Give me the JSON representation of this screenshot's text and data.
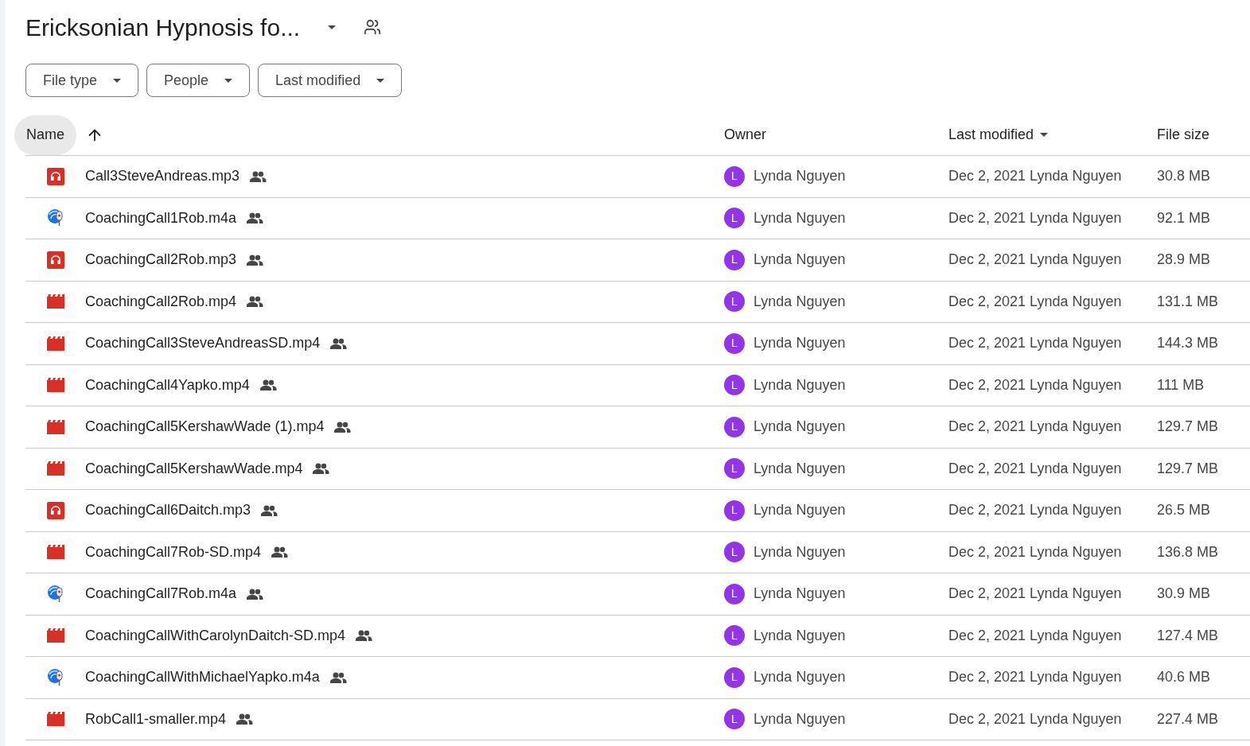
{
  "folder": {
    "title": "Ericksonian Hypnosis fo..."
  },
  "filters": [
    {
      "label": "File type"
    },
    {
      "label": "People"
    },
    {
      "label": "Last modified"
    }
  ],
  "columns": {
    "name": {
      "label": "Name",
      "selected": true
    },
    "owner": "Owner",
    "modified": "Last modified",
    "size": "File size"
  },
  "rows": [
    {
      "name": "Call3SteveAndreas.mp3",
      "kind": "audio",
      "owner": "Lynda Nguyen",
      "initial": "L",
      "color": "#9334e6",
      "modified": "Dec 2, 2021 Lynda Nguyen",
      "size": "30.8 MB"
    },
    {
      "name": "CoachingCall1Rob.m4a",
      "kind": "m4a",
      "owner": "Lynda Nguyen",
      "initial": "L",
      "color": "#9334e6",
      "modified": "Dec 2, 2021 Lynda Nguyen",
      "size": "92.1 MB"
    },
    {
      "name": "CoachingCall2Rob.mp3",
      "kind": "audio",
      "owner": "Lynda Nguyen",
      "initial": "L",
      "color": "#9334e6",
      "modified": "Dec 2, 2021 Lynda Nguyen",
      "size": "28.9 MB"
    },
    {
      "name": "CoachingCall2Rob.mp4",
      "kind": "video",
      "owner": "Lynda Nguyen",
      "initial": "L",
      "color": "#9334e6",
      "modified": "Dec 2, 2021 Lynda Nguyen",
      "size": "131.1 MB"
    },
    {
      "name": "CoachingCall3SteveAndreasSD.mp4",
      "kind": "video",
      "owner": "Lynda Nguyen",
      "initial": "L",
      "color": "#9334e6",
      "modified": "Dec 2, 2021 Lynda Nguyen",
      "size": "144.3 MB"
    },
    {
      "name": "CoachingCall4Yapko.mp4",
      "kind": "video",
      "owner": "Lynda Nguyen",
      "initial": "L",
      "color": "#9334e6",
      "modified": "Dec 2, 2021 Lynda Nguyen",
      "size": "111 MB"
    },
    {
      "name": "CoachingCall5KershawWade (1).mp4",
      "kind": "video",
      "owner": "Lynda Nguyen",
      "initial": "L",
      "color": "#9334e6",
      "modified": "Dec 2, 2021 Lynda Nguyen",
      "size": "129.7 MB"
    },
    {
      "name": "CoachingCall5KershawWade.mp4",
      "kind": "video",
      "owner": "Lynda Nguyen",
      "initial": "L",
      "color": "#9334e6",
      "modified": "Dec 2, 2021 Lynda Nguyen",
      "size": "129.7 MB"
    },
    {
      "name": "CoachingCall6Daitch.mp3",
      "kind": "audio",
      "owner": "Lynda Nguyen",
      "initial": "L",
      "color": "#9334e6",
      "modified": "Dec 2, 2021 Lynda Nguyen",
      "size": "26.5 MB"
    },
    {
      "name": "CoachingCall7Rob-SD.mp4",
      "kind": "video",
      "owner": "Lynda Nguyen",
      "initial": "L",
      "color": "#9334e6",
      "modified": "Dec 2, 2021 Lynda Nguyen",
      "size": "136.8 MB"
    },
    {
      "name": "CoachingCall7Rob.m4a",
      "kind": "m4a",
      "owner": "Lynda Nguyen",
      "initial": "L",
      "color": "#9334e6",
      "modified": "Dec 2, 2021 Lynda Nguyen",
      "size": "30.9 MB"
    },
    {
      "name": "CoachingCallWithCarolynDaitch-SD.mp4",
      "kind": "video",
      "owner": "Lynda Nguyen",
      "initial": "L",
      "color": "#9334e6",
      "modified": "Dec 2, 2021 Lynda Nguyen",
      "size": "127.4 MB"
    },
    {
      "name": "CoachingCallWithMichaelYapko.m4a",
      "kind": "m4a",
      "owner": "Lynda Nguyen",
      "initial": "L",
      "color": "#9334e6",
      "modified": "Dec 2, 2021 Lynda Nguyen",
      "size": "40.6 MB"
    },
    {
      "name": "RobCall1-smaller.mp4",
      "kind": "video",
      "owner": "Lynda Nguyen",
      "initial": "L",
      "color": "#9334e6",
      "modified": "Dec 2, 2021 Lynda Nguyen",
      "size": "227.4 MB"
    }
  ]
}
